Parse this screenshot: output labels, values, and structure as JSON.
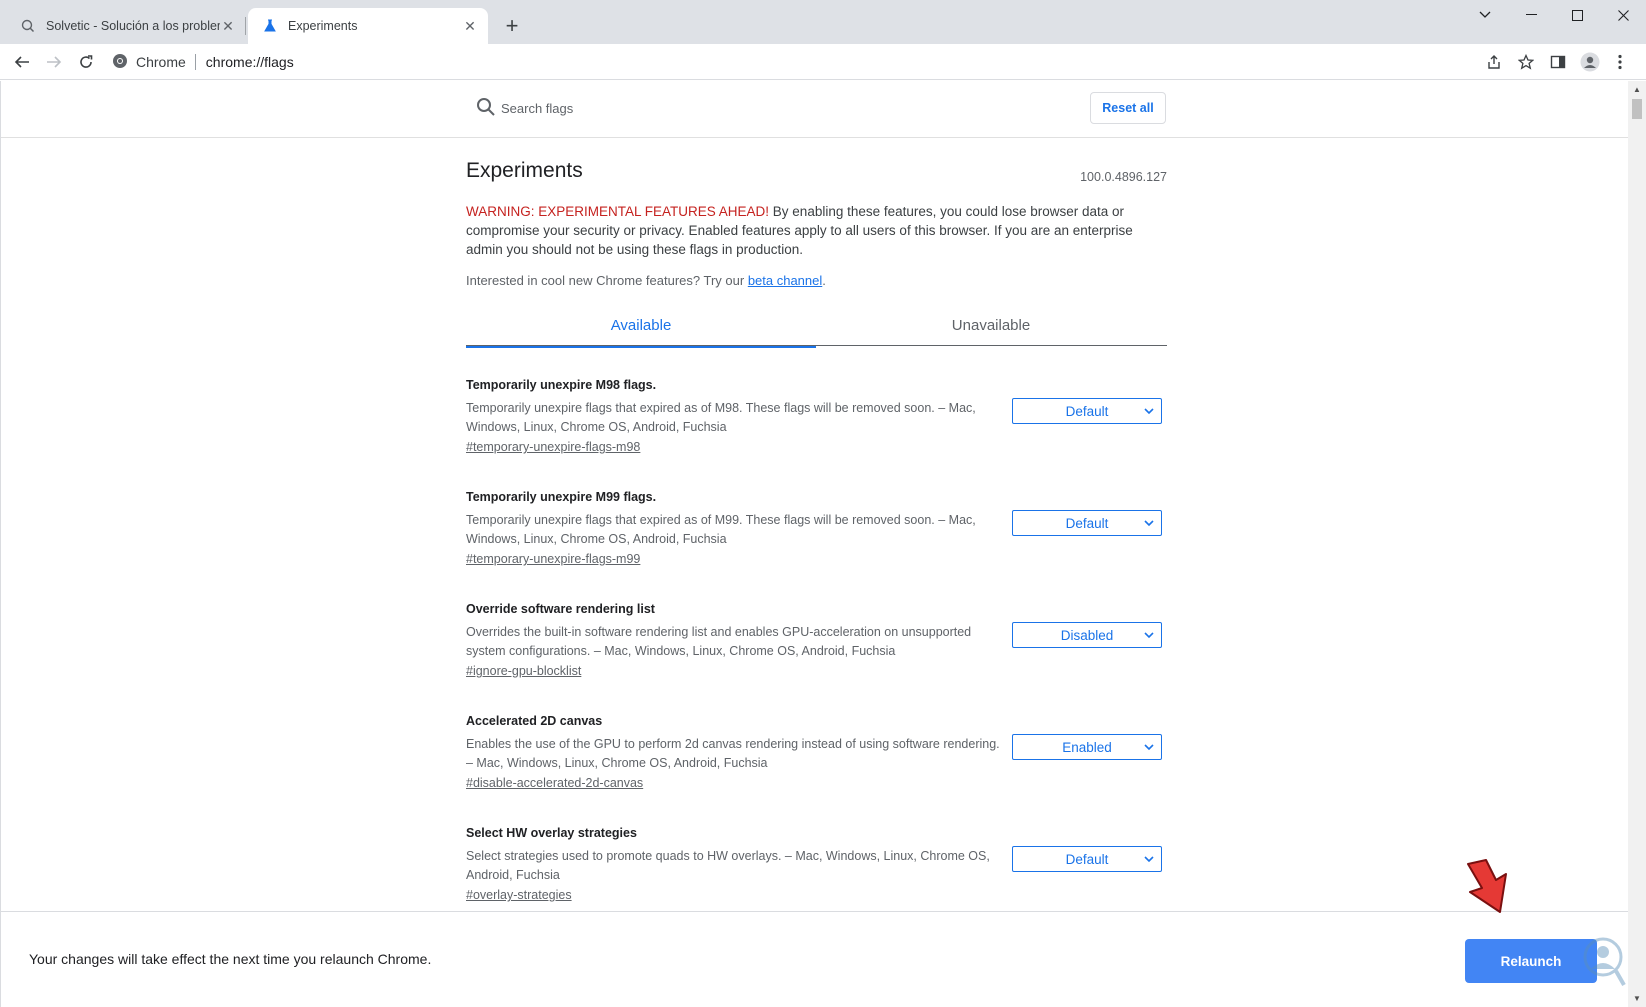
{
  "browser": {
    "tabs": [
      {
        "title": "Solvetic - Solución a los problem",
        "active": false
      },
      {
        "title": "Experiments",
        "active": true
      }
    ],
    "omnibox": {
      "chip": "Chrome",
      "url": "chrome://flags"
    }
  },
  "search": {
    "placeholder": "Search flags",
    "reset_label": "Reset all"
  },
  "header": {
    "title": "Experiments",
    "version": "100.0.4896.127",
    "warning_red": "WARNING: EXPERIMENTAL FEATURES AHEAD!",
    "warning_rest": " By enabling these features, you could lose browser data or compromise your security or privacy. Enabled features apply to all users of this browser. If you are an enterprise admin you should not be using these flags in production.",
    "beta_text": "Interested in cool new Chrome features? Try our ",
    "beta_link": "beta channel",
    "beta_end": "."
  },
  "tabs": {
    "available": "Available",
    "unavailable": "Unavailable"
  },
  "flags": [
    {
      "name": "Temporarily unexpire M98 flags.",
      "description": "Temporarily unexpire flags that expired as of M98. These flags will be removed soon. – Mac, Windows, Linux, Chrome OS, Android, Fuchsia",
      "link": "#temporary-unexpire-flags-m98",
      "value": "Default"
    },
    {
      "name": "Temporarily unexpire M99 flags.",
      "description": "Temporarily unexpire flags that expired as of M99. These flags will be removed soon. – Mac, Windows, Linux, Chrome OS, Android, Fuchsia",
      "link": "#temporary-unexpire-flags-m99",
      "value": "Default"
    },
    {
      "name": "Override software rendering list",
      "description": "Overrides the built-in software rendering list and enables GPU-acceleration on unsupported system configurations. – Mac, Windows, Linux, Chrome OS, Android, Fuchsia",
      "link": "#ignore-gpu-blocklist",
      "value": "Disabled"
    },
    {
      "name": "Accelerated 2D canvas",
      "description": "Enables the use of the GPU to perform 2d canvas rendering instead of using software rendering. – Mac, Windows, Linux, Chrome OS, Android, Fuchsia",
      "link": "#disable-accelerated-2d-canvas",
      "value": "Enabled"
    },
    {
      "name": "Select HW overlay strategies",
      "description": "Select strategies used to promote quads to HW overlays. – Mac, Windows, Linux, Chrome OS, Android, Fuchsia",
      "link": "#overlay-strategies",
      "value": "Default"
    }
  ],
  "footer": {
    "message": "Your changes will take effect the next time you relaunch Chrome.",
    "relaunch_label": "Relaunch"
  },
  "icons": {
    "tab1": "solvetic-favicon-icon",
    "tab2": "experiments-flask-icon",
    "back": "back-arrow-icon",
    "forward": "forward-arrow-icon",
    "reload": "reload-icon",
    "share": "share-icon",
    "star": "bookmark-star-icon",
    "sidepanel": "side-panel-icon",
    "profile": "profile-avatar-icon",
    "menu": "kebab-menu-icon"
  },
  "colors": {
    "accent": "#1a73e8",
    "warning": "#c5221f",
    "relaunch": "#4285f4",
    "annotation_arrow": "#e53935"
  }
}
